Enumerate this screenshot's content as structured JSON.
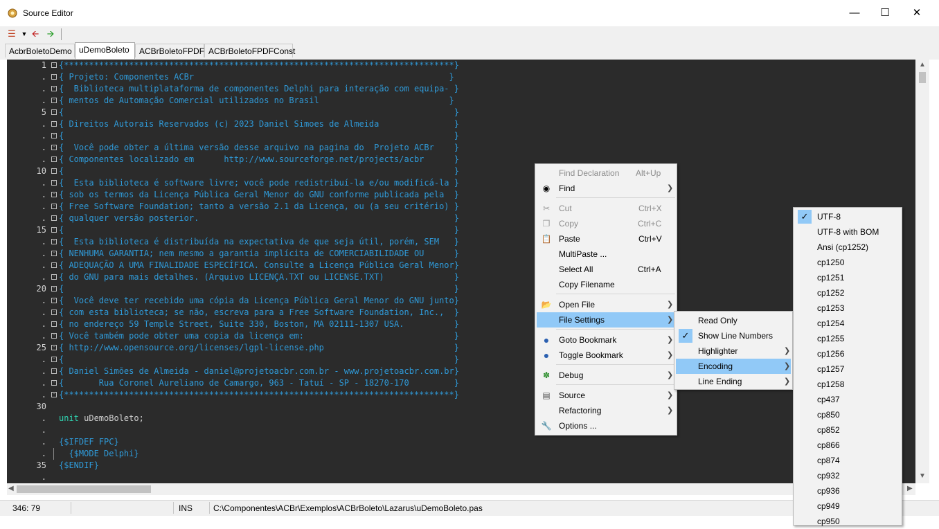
{
  "window": {
    "title": "Source Editor"
  },
  "tabs": [
    {
      "label": "AcbrBoletoDemo"
    },
    {
      "label": "uDemoBoleto"
    },
    {
      "label": "ACBrBoletoFPDF"
    },
    {
      "label": "ACBrBoletoFPDFConst"
    }
  ],
  "gutter": [
    "1",
    ".",
    ".",
    ".",
    "5",
    ".",
    ".",
    ".",
    ".",
    "10",
    ".",
    ".",
    ".",
    ".",
    "15",
    ".",
    ".",
    ".",
    ".",
    "20",
    ".",
    ".",
    ".",
    ".",
    "25",
    ".",
    ".",
    ".",
    ".",
    "30",
    ".",
    ".",
    ".",
    ".",
    "35",
    "."
  ],
  "code": [
    "{******************************************************************************}",
    "{ Projeto: Componentes ACBr                                                   }",
    "{  Biblioteca multiplataforma de componentes Delphi para interação com equipa- }",
    "{ mentos de Automação Comercial utilizados no Brasil                          }",
    "{                                                                              }",
    "{ Direitos Autorais Reservados (c) 2023 Daniel Simoes de Almeida               }",
    "{                                                                              }",
    "{  Você pode obter a última versão desse arquivo na pagina do  Projeto ACBr    }",
    "{ Componentes localizado em      http://www.sourceforge.net/projects/acbr      }",
    "{                                                                              }",
    "{  Esta biblioteca é software livre; você pode redistribuí-la e/ou modificá-la }",
    "{ sob os termos da Licença Pública Geral Menor do GNU conforme publicada pela  }",
    "{ Free Software Foundation; tanto a versão 2.1 da Licença, ou (a seu critério) }",
    "{ qualquer versão posterior.                                                   }",
    "{                                                                              }",
    "{  Esta biblioteca é distribuída na expectativa de que seja útil, porém, SEM   }",
    "{ NENHUMA GARANTIA; nem mesmo a garantia implícita de COMERCIABILIDADE OU      }",
    "{ ADEQUAÇÃO A UMA FINALIDADE ESPECÍFICA. Consulte a Licença Pública Geral Menor}",
    "{ do GNU para mais detalhes. (Arquivo LICENÇA.TXT ou LICENSE.TXT)              }",
    "{                                                                              }",
    "{  Você deve ter recebido uma cópia da Licença Pública Geral Menor do GNU junto}",
    "{ com esta biblioteca; se não, escreva para a Free Software Foundation, Inc.,  }",
    "{ no endereço 59 Temple Street, Suite 330, Boston, MA 02111-1307 USA.          }",
    "{ Você também pode obter uma copia da licença em:                              }",
    "{ http://www.opensource.org/licenses/lgpl-license.php                          }",
    "{                                                                              }",
    "{ Daniel Simões de Almeida - daniel@projetoacbr.com.br - www.projetoacbr.com.br}",
    "{       Rua Coronel Aureliano de Camargo, 963 - Tatuí - SP - 18270-170         }",
    "{******************************************************************************}"
  ],
  "code_tail": {
    "unit_kw": "unit",
    "unit_name": " uDemoBoleto;",
    "ifdef": "{$IFDEF FPC}",
    "mode": "  {$MODE Delphi}",
    "endif": "{$ENDIF}"
  },
  "context_menu": {
    "find_declaration": {
      "label": "Find Declaration",
      "shortcut": "Alt+Up"
    },
    "find": {
      "label": "Find"
    },
    "cut": {
      "label": "Cut",
      "shortcut": "Ctrl+X"
    },
    "copy": {
      "label": "Copy",
      "shortcut": "Ctrl+C"
    },
    "paste": {
      "label": "Paste",
      "shortcut": "Ctrl+V"
    },
    "multipaste": {
      "label": "MultiPaste ..."
    },
    "select_all": {
      "label": "Select All",
      "shortcut": "Ctrl+A"
    },
    "copy_filename": {
      "label": "Copy Filename"
    },
    "open_file": {
      "label": "Open File"
    },
    "file_settings": {
      "label": "File Settings"
    },
    "goto_bookmark": {
      "label": "Goto Bookmark"
    },
    "toggle_bookmark": {
      "label": "Toggle Bookmark"
    },
    "debug": {
      "label": "Debug"
    },
    "source": {
      "label": "Source"
    },
    "refactoring": {
      "label": "Refactoring"
    },
    "options": {
      "label": "Options ..."
    }
  },
  "file_settings_menu": {
    "read_only": "Read Only",
    "show_line_numbers": "Show Line Numbers",
    "highlighter": "Highlighter",
    "encoding": "Encoding",
    "line_ending": "Line Ending"
  },
  "encoding_menu": [
    "UTF-8",
    "UTF-8 with BOM",
    "Ansi (cp1252)",
    "cp1250",
    "cp1251",
    "cp1252",
    "cp1253",
    "cp1254",
    "cp1255",
    "cp1256",
    "cp1257",
    "cp1258",
    "cp437",
    "cp850",
    "cp852",
    "cp866",
    "cp874",
    "cp932",
    "cp936",
    "cp949",
    "cp950"
  ],
  "status": {
    "position": "346: 79",
    "mode": "INS",
    "path": "C:\\Componentes\\ACBr\\Exemplos\\ACBrBoleto\\Lazarus\\uDemoBoleto.pas"
  }
}
